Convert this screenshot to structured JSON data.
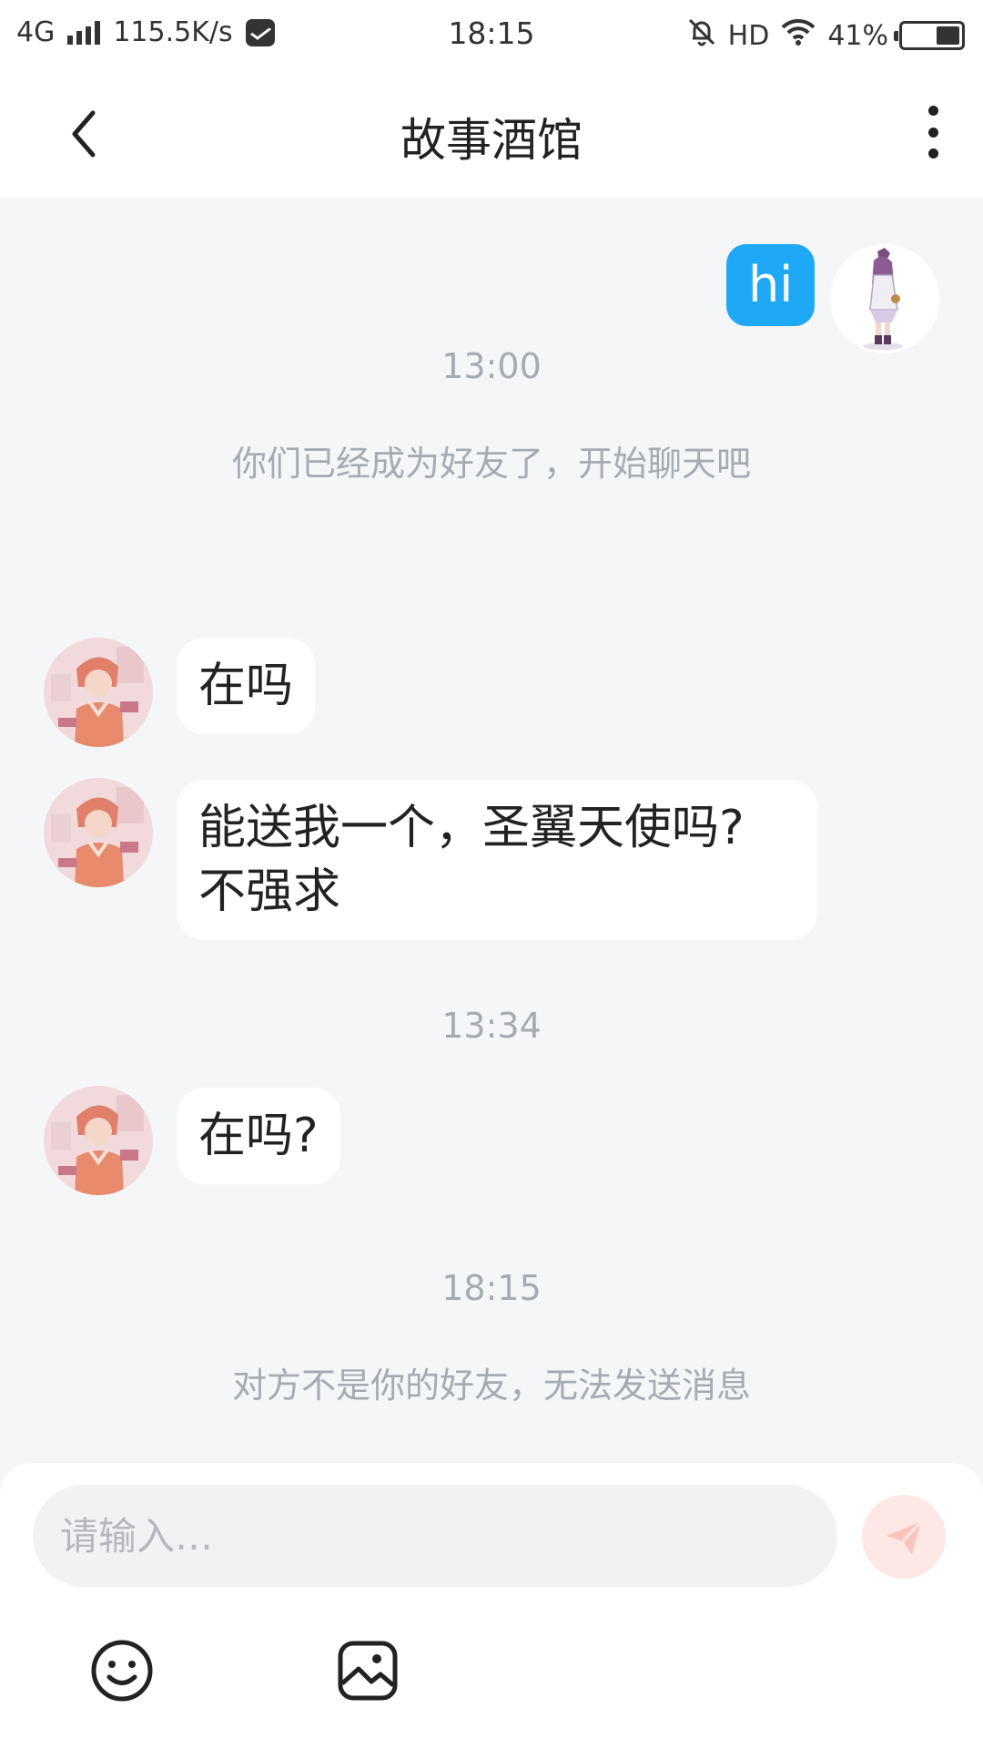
{
  "status_bar": {
    "network": "4G",
    "speed": "115.5K/s",
    "time": "18:15",
    "hd": "HD",
    "battery": "41%",
    "battery_level": 0.41
  },
  "header": {
    "title": "故事酒馆"
  },
  "messages": {
    "me_hi": "hi",
    "time_1": "13:00",
    "sys_friends": "你们已经成为好友了，开始聊天吧",
    "msg_1": "在吗",
    "msg_2_line1": "能送我一个，圣翼天使吗?",
    "msg_2_line2": "不强求",
    "time_2": "13:34",
    "msg_3": "在吗?",
    "time_3": "18:15",
    "sys_blocked": "对方不是你的好友，无法发送消息"
  },
  "composer": {
    "placeholder": "请输入…"
  },
  "icons": {
    "back": "chevron-left-icon",
    "more": "more-vertical-icon",
    "send": "send-icon",
    "emoji": "emoji-icon",
    "image": "image-icon"
  },
  "colors": {
    "accent_bubble": "#1fa8f5",
    "background": "#f4f6f8",
    "muted_text": "#a6abb2",
    "send_disabled": "#fde8e6"
  }
}
